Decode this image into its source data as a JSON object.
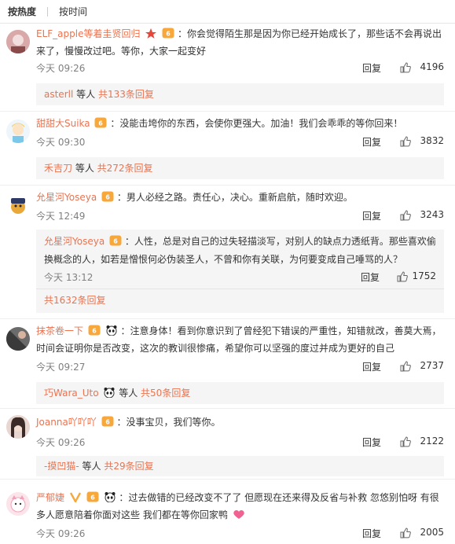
{
  "tabs": {
    "hot": "按热度",
    "time": "按时间"
  },
  "comments": [
    {
      "user": "ELF_apple等着圭贤回归",
      "sep": "：",
      "text": "你会觉得陌生那是因为你已经开始成长了，那些话不会再说出来了，慢慢改过吧。等你，大家一起变好",
      "time": "今天 09:26",
      "reply": "回复",
      "likes": "4196",
      "sub_users": "asterll",
      "sub_mid": " 等人 ",
      "sub_total": "共133条回复"
    },
    {
      "user": "甜甜大Suika",
      "sep": "：",
      "text": "没能击垮你的东西，会使你更强大。加油！我们会乖乖的等你回来！",
      "time": "今天 09:30",
      "reply": "回复",
      "likes": "3832",
      "sub_users": "禾吉刀",
      "sub_mid": " 等人 ",
      "sub_total": "共272条回复"
    },
    {
      "user": "允星河Yoseya",
      "sep": "：",
      "text": "男人必经之路。责任心，决心。重新启航，随时欢迎。",
      "time": "今天 12:49",
      "reply": "回复",
      "likes": "3243",
      "inner_user": "允星河Yoseya",
      "inner_text": "人性，总是对自己的过失轻描淡写，对别人的缺点力透纸背。那些喜欢偷换概念的人，如若是憎恨何必伪装圣人，不曾和你有关联，为何要变成自己唾骂的人？",
      "inner_time": "今天 13:12",
      "inner_reply": "回复",
      "inner_likes": "1752",
      "sub_total": "共1632条回复"
    },
    {
      "user": "抹茶卷一下",
      "sep": "：",
      "text": "注意身体！看到你意识到了曾经犯下错误的严重性，知错就改，善莫大焉，时间会证明你是否改变，这次的教训很惨痛，希望你可以坚强的度过并成为更好的自己",
      "time": "今天 09:27",
      "reply": "回复",
      "likes": "2737",
      "sub_users": "巧Wara_Uto",
      "sub_mid": " 等人 ",
      "sub_total": "共50条回复"
    },
    {
      "user": "Joanna吖吖吖",
      "sep": "：",
      "text": "没事宝贝，我们等你。",
      "time": "今天 09:26",
      "reply": "回复",
      "likes": "2122",
      "sub_users": "-摸凹猫-",
      "sub_mid": " 等人 ",
      "sub_total": "共29条回复"
    },
    {
      "user": "严郁婕",
      "sep": "：",
      "text": "过去做错的已经改变不了了 但愿现在还来得及反省与补救 忽悠别怕呀 有很多人愿意陪着你面对这些 我们都在等你回家鸭",
      "time": "今天 09:26",
      "reply": "回复",
      "likes": "2005"
    }
  ],
  "colors": {
    "link": "#eb7350",
    "badge": "#f8a83a",
    "heart": "#f06292",
    "star": "#e8463a"
  },
  "icons": [
    "vip-badge-icon",
    "star-icon",
    "panda-icon",
    "heart-icon",
    "like-icon",
    "v-verified-icon"
  ]
}
